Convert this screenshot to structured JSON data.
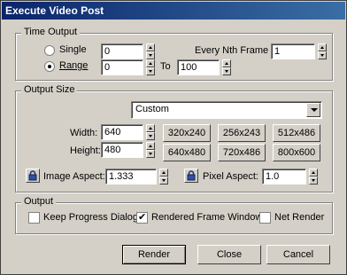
{
  "window": {
    "title": "Execute Video Post"
  },
  "time_output": {
    "label": "Time Output",
    "single_label": "Single",
    "range_label": "Range",
    "single_value": "0",
    "range_from": "0",
    "to_label": "To",
    "range_to": "100",
    "nth_frame_label": "Every Nth Frame",
    "nth_frame_value": "1",
    "selected": "Range"
  },
  "output_size": {
    "label": "Output Size",
    "preset": "Custom",
    "width_label": "Width:",
    "width_value": "640",
    "height_label": "Height:",
    "height_value": "480",
    "presets": [
      "320x240",
      "256x243",
      "512x486",
      "640x480",
      "720x486",
      "800x600"
    ],
    "image_aspect_label": "Image Aspect:",
    "image_aspect_value": "1.333",
    "pixel_aspect_label": "Pixel Aspect:",
    "pixel_aspect_value": "1.0"
  },
  "output": {
    "label": "Output",
    "keep_progress_label": "Keep Progress Dialog",
    "keep_progress_checked": false,
    "rendered_frame_label": "Rendered Frame Window",
    "rendered_frame_checked": true,
    "net_render_label": "Net Render",
    "net_render_checked": false
  },
  "buttons": {
    "render": "Render",
    "close": "Close",
    "cancel": "Cancel"
  }
}
